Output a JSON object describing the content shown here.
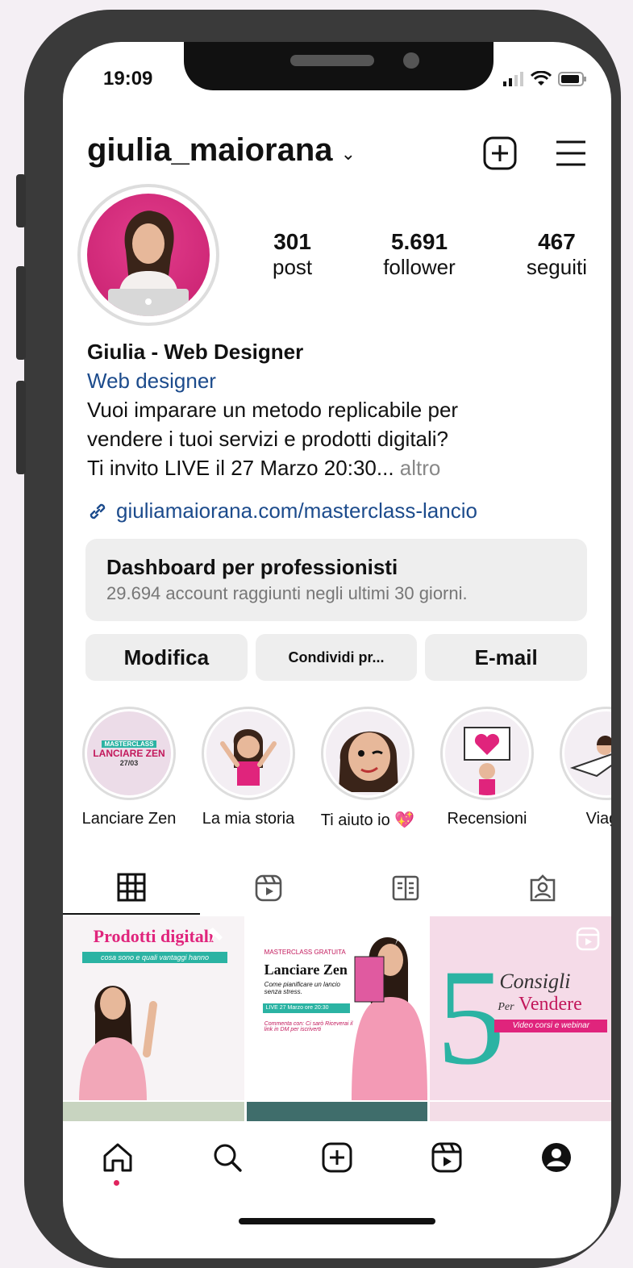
{
  "status_bar": {
    "time": "19:09"
  },
  "profile": {
    "username": "giulia_maiorana",
    "stats": [
      {
        "value": "301",
        "label": "post"
      },
      {
        "value": "5.691",
        "label": "follower"
      },
      {
        "value": "467",
        "label": "seguiti"
      }
    ],
    "bio_name": "Giulia - Web Designer",
    "bio_category": "Web designer",
    "bio_line1": "Vuoi imparare un metodo replicabile per",
    "bio_line2": "vendere i tuoi servizi e prodotti digitali?",
    "bio_line3": "Ti invito LIVE il 27 Marzo 20:30...",
    "bio_more": " altro",
    "link": "giuliamaiorana.com/masterclass-lancio"
  },
  "dashboard": {
    "title": "Dashboard per professionisti",
    "subtitle": "29.694 account raggiunti negli ultimi 30 giorni."
  },
  "actions": {
    "edit": "Modifica",
    "share": "Condividi pr...",
    "email": "E-mail"
  },
  "highlights": [
    {
      "label": "Lanciare Zen",
      "text_top": "MASTERCLASS",
      "text_mid": "LANCIARE ZEN",
      "text_bot": "27/03"
    },
    {
      "label": "La mia storia"
    },
    {
      "label": "Ti aiuto io 💖"
    },
    {
      "label": "Recensioni"
    },
    {
      "label": "Viagg"
    }
  ],
  "posts": [
    {
      "title": "Prodotti digitali",
      "subtitle": "cosa sono e quali vantaggi hanno"
    },
    {
      "kicker": "MASTERCLASS GRATUITA",
      "title": "Lanciare Zen",
      "subtitle": "Come pianificare un lancio senza stress.",
      "date": "LIVE 27 Marzo ore 20:30",
      "footer": "Commenta con: Ci sarò Riceverai il link in DM per iscriverti"
    },
    {
      "number": "5",
      "title": "Consigli",
      "per": "Per",
      "title2": "Vendere",
      "subtitle": "Video corsi e webinar"
    }
  ],
  "colors": {
    "link": "#1c4b8c",
    "accent": "#e0245e",
    "teal": "#2bb3a3"
  }
}
